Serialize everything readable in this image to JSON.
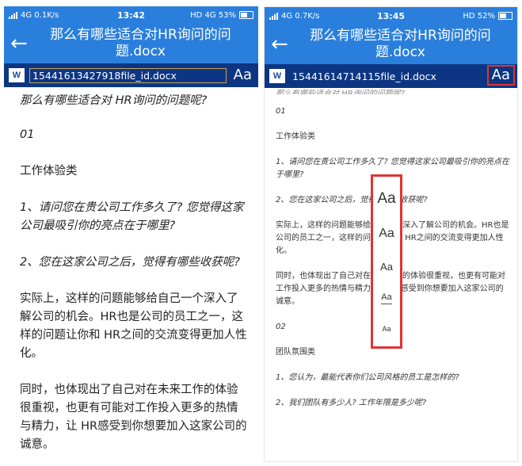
{
  "left": {
    "status": {
      "left": "4G 0.1K/s",
      "time": "13:42",
      "right": "HD 4G 53%"
    },
    "title": "那么有哪些适合对HR询问的问题.docx",
    "back_icon": "arrow-left",
    "word_icon_label": "W",
    "filename": "15441613427918file_id.docx",
    "font_button": "Aa",
    "paragraphs": [
      "那么有哪些适合对 HR询问的问题呢?",
      "01",
      "工作体验类",
      "1、请问您在贵公司工作多久了? 您觉得这家公司最吸引你的亮点在于哪里?",
      "2、您在这家公司之后，觉得有哪些收获呢?",
      "实际上，这样的问题能够给自己一个深入了解公司的机会。HR也是公司的员工之一，这样的问题让你和 HR之间的交流变得更加人性化。",
      "同时，也体现出了自己对在未来工作的体验很重视，也更有可能对工作投入更多的热情与精力，让 HR感受到你想要加入这家公司的诚意。"
    ]
  },
  "right": {
    "status": {
      "left": "4G 0.7K/s",
      "time": "13:45",
      "right": "HD 52%"
    },
    "title": "那么有哪些适合对HR询问的问题.docx",
    "back_icon": "arrow-left",
    "word_icon_label": "W",
    "filename": "15441614714115file_id.docx",
    "font_button": "Aa",
    "paragraphs": [
      "那么有哪些适合对 HR询问的问题呢?",
      "01",
      "工作体验类",
      "1、请问您在贵公司工作多久了? 您觉得这家公司最吸引你的亮点在于哪里?",
      "2、您在这家公司之后，觉得有哪些收获呢?",
      "实际上，这样的问题能够给自己一个深入了解公司的机会。HR也是公司的员工之一，这样的问题让你和 HR之间的交流变得更加人性化。",
      "同时，也体现出了自己对在未来工作的体验很重视，也更有可能对工作投入更多的热情与精力，让 HR感受到你想要加入这家公司的诚意。",
      "02",
      "团队氛围类",
      "1、您认为，最能代表你们公司风格的员工是怎样的?",
      "2、我们团队有多少人? 工作年限是多少呢?"
    ],
    "font_sizes": [
      "Aa",
      "Aa",
      "Aa",
      "Aa",
      "Aa"
    ]
  },
  "colors": {
    "header": "#2b7fdc",
    "toolbar": "#0c3683",
    "highlight": "#e03333"
  }
}
